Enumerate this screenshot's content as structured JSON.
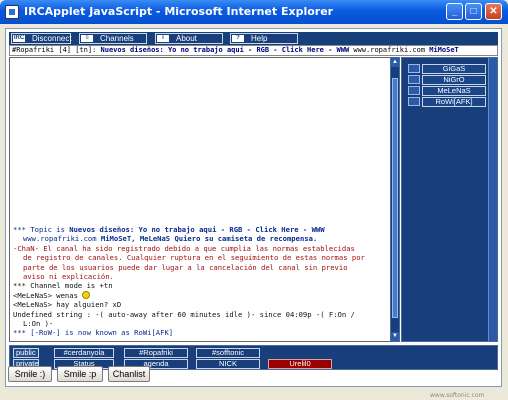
{
  "window": {
    "title": "IRCApplet JavaScript - Microsoft Internet Explorer",
    "min_glyph": "_",
    "max_glyph": "□",
    "close_glyph": "✕"
  },
  "toolbar": {
    "disconnect_label": "Disconnect",
    "channels_label": "Channels",
    "about_label": "About",
    "help_label": "Help",
    "disconnect_icon_text": "IRC",
    "about_icon_text": "i",
    "help_icon_text": "?"
  },
  "topic_bar": {
    "prefix": "#Ropafriki [4] [tn]: ",
    "bold": "Nuevos diseños: Yo no trabajo aquí - RGB - Click Here - WWW",
    "mid": " www.ropafriki.com ",
    "tail": "MiMoSeT"
  },
  "chat": {
    "lines": [
      {
        "cls": "blue",
        "parts": [
          {
            "t": "*** Topic is  "
          },
          {
            "t": "Nuevos diseños: Yo no trabajo aqui - RGB - Click Here - WWW",
            "b": true
          }
        ]
      },
      {
        "cls": "blue",
        "indent": true,
        "parts": [
          {
            "t": "www.ropafriki.com "
          },
          {
            "t": "MiMoSeT, MeLeNaS Quiero su camiseta de recompensa.",
            "b": true
          }
        ]
      },
      {
        "cls": "red",
        "parts": [
          {
            "t": "-ChaN-  El canal ha sido registrado debido a que cumplia las normas establecidas"
          }
        ]
      },
      {
        "cls": "red",
        "indent": true,
        "parts": [
          {
            "t": "de registro de canales. Cualquier ruptura en el seguimiento de estas normas por"
          }
        ]
      },
      {
        "cls": "red",
        "indent": true,
        "parts": [
          {
            "t": "parte de los usuarios puede dar lugar a la cancelación del canal sin previo"
          }
        ]
      },
      {
        "cls": "red",
        "indent": true,
        "parts": [
          {
            "t": "aviso ni explicación."
          }
        ]
      },
      {
        "cls": "black",
        "parts": [
          {
            "t": "*** Channel mode is +tn"
          }
        ]
      },
      {
        "cls": "black",
        "smiley": true,
        "parts": [
          {
            "t": "<MeLeNaS> wenas "
          }
        ]
      },
      {
        "cls": "black",
        "parts": [
          {
            "t": "<MeLeNaS> hay alguien? xD"
          }
        ]
      },
      {
        "cls": "black",
        "parts": [
          {
            "t": "Undefined string : -( auto-away after 60 minutes idle )- since 04:09p -( F:On /"
          }
        ]
      },
      {
        "cls": "black",
        "indent": true,
        "parts": [
          {
            "t": "L:On )-"
          }
        ]
      },
      {
        "cls": "blue",
        "parts": [
          {
            "t": "*** [-RoW-] is now known as RoWi[AFK]"
          }
        ]
      }
    ]
  },
  "nicklist": {
    "nicks": [
      "GiGaS",
      "NiGrO",
      "MeLeNaS",
      "RoWi[AFK]"
    ]
  },
  "tabs": {
    "public_label": "public",
    "private_label": "private",
    "public": [
      "#cerdanyola",
      "#Ropafriki",
      "#sofftonic"
    ],
    "private": [
      {
        "label": "Status",
        "active": false
      },
      {
        "label": "agenda",
        "active": false
      },
      {
        "label": "NICK",
        "active": false
      },
      {
        "label": "Urelil0",
        "active": true
      }
    ]
  },
  "buttons": {
    "smile": "Smile :)",
    "smile_p": "Smile :p",
    "chanlist": "Chanlist"
  },
  "watermark": "www.softonic.com"
}
